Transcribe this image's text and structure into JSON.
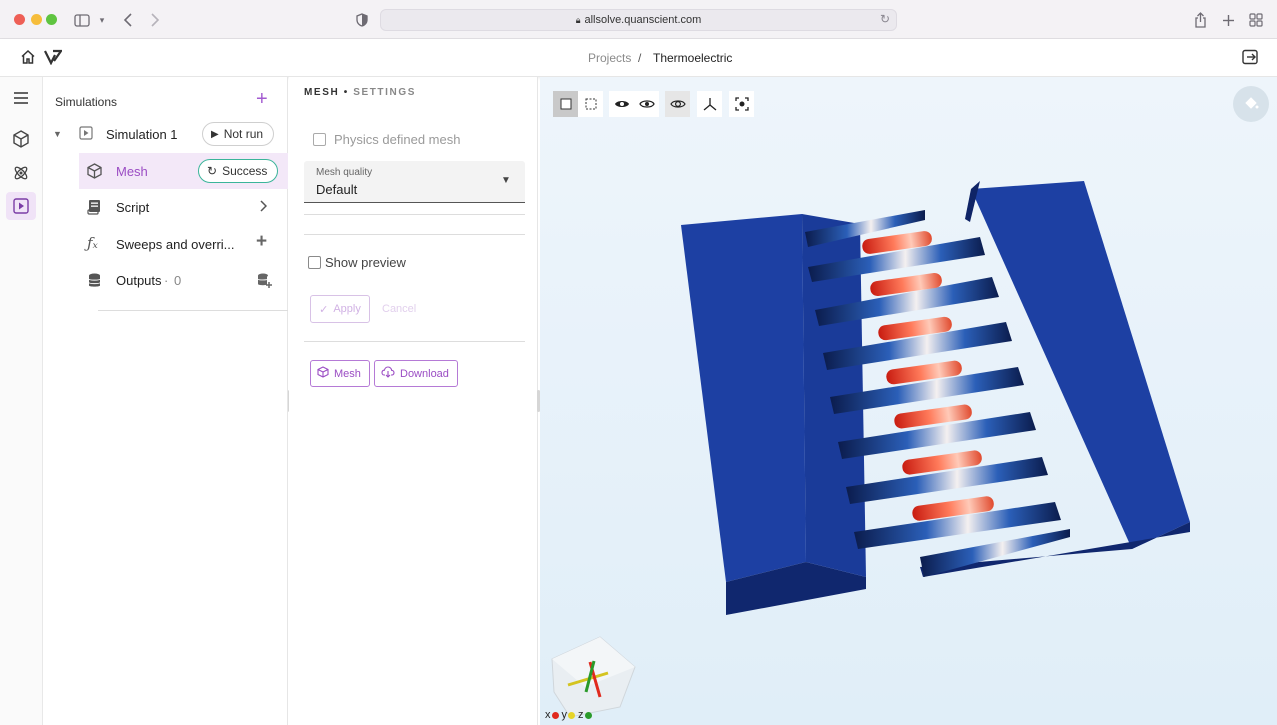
{
  "browser": {
    "url": "allsolve.quanscient.com"
  },
  "header": {
    "breadcrumb_root": "Projects",
    "breadcrumb_sep": "/",
    "breadcrumb_current": "Thermoelectric"
  },
  "sidebar": {
    "title": "Simulations",
    "simulation": {
      "label": "Simulation 1",
      "status": "Not run"
    },
    "items": [
      {
        "label": "Mesh",
        "status": "Success"
      },
      {
        "label": "Script"
      },
      {
        "label": "Sweeps and overri..."
      },
      {
        "label": "Outputs",
        "count_sep": "·",
        "count": "0"
      }
    ]
  },
  "settings": {
    "header_main": "MESH",
    "header_dot": "•",
    "header_sub": "SETTINGS",
    "physics_mesh_label": "Physics defined mesh",
    "mesh_quality_label": "Mesh quality",
    "mesh_quality_value": "Default",
    "show_preview_label": "Show preview",
    "apply_label": "Apply",
    "cancel_label": "Cancel",
    "mesh_button": "Mesh",
    "download_button": "Download"
  },
  "axes": {
    "x": "x",
    "y": "y",
    "z": "z"
  },
  "colors": {
    "accent": "#9b4dc4",
    "success": "#3bb59a",
    "device_blue": "#1c3f9e",
    "hot_red": "#e0301e"
  }
}
